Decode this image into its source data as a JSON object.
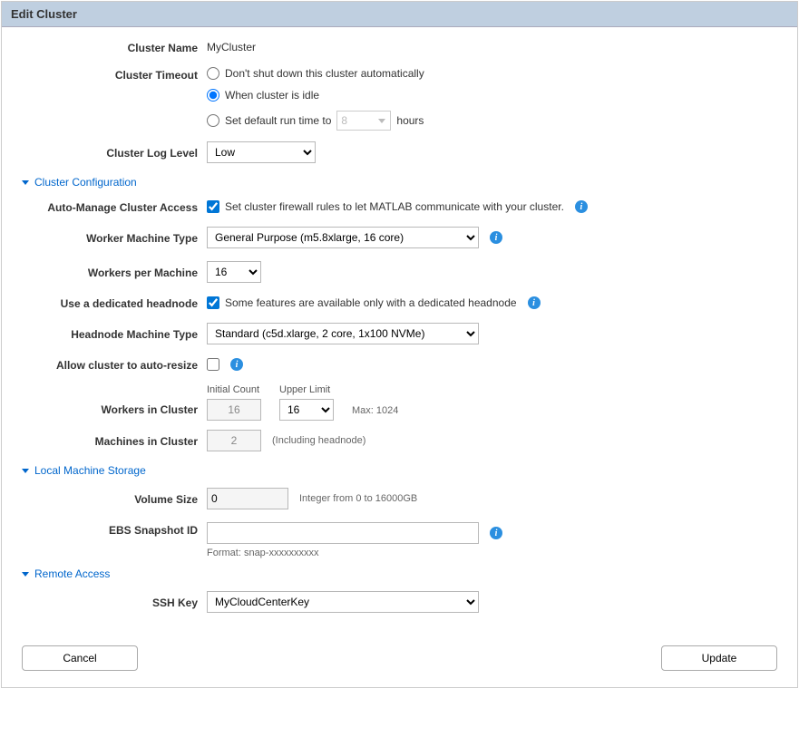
{
  "dialog": {
    "title": "Edit Cluster"
  },
  "main": {
    "clusterNameLabel": "Cluster Name",
    "clusterNameValue": "MyCluster",
    "clusterTimeoutLabel": "Cluster Timeout",
    "timeoutOptions": {
      "opt1": "Don't shut down this cluster automatically",
      "opt2": "When cluster is idle",
      "opt3a": "Set default run time to",
      "opt3hours": "8",
      "opt3b": "hours"
    },
    "clusterLogLevelLabel": "Cluster Log Level",
    "clusterLogLevelValue": "Low"
  },
  "sections": {
    "clusterConfig": "Cluster Configuration",
    "localStorage": "Local Machine Storage",
    "remoteAccess": "Remote Access"
  },
  "clusterConfig": {
    "autoManageLabel": "Auto-Manage Cluster Access",
    "autoManageText": "Set cluster firewall rules to let MATLAB communicate with your cluster.",
    "workerMachineTypeLabel": "Worker Machine Type",
    "workerMachineTypeValue": "General Purpose (m5.8xlarge, 16 core)",
    "workersPerMachineLabel": "Workers per Machine",
    "workersPerMachineValue": "16",
    "dedicatedHeadnodeLabel": "Use a dedicated headnode",
    "dedicatedHeadnodeText": "Some features are available only with a dedicated headnode",
    "headnodeMachineTypeLabel": "Headnode Machine Type",
    "headnodeMachineTypeValue": "Standard (c5d.xlarge, 2 core, 1x100 NVMe)",
    "autoResizeLabel": "Allow cluster to auto-resize",
    "initialCountLabel": "Initial Count",
    "upperLimitLabel": "Upper Limit",
    "workersInClusterLabel": "Workers in Cluster",
    "workersInClusterInitial": "16",
    "workersInClusterUpper": "16",
    "workersInClusterMax": "Max: 1024",
    "machinesInClusterLabel": "Machines in Cluster",
    "machinesInClusterValue": "2",
    "machinesInClusterHint": "(Including headnode)"
  },
  "localStorage": {
    "volumeSizeLabel": "Volume Size",
    "volumeSizeValue": "0",
    "volumeSizeHint": "Integer from 0 to 16000GB",
    "ebsSnapshotLabel": "EBS Snapshot ID",
    "ebsSnapshotValue": "",
    "ebsSnapshotHint": "Format: snap-xxxxxxxxxx"
  },
  "remoteAccess": {
    "sshKeyLabel": "SSH Key",
    "sshKeyValue": "MyCloudCenterKey"
  },
  "buttons": {
    "cancel": "Cancel",
    "update": "Update"
  }
}
